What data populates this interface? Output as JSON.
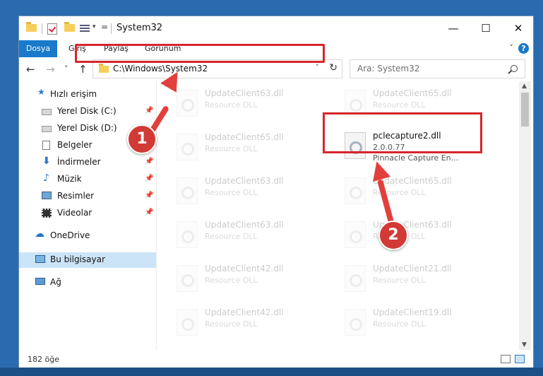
{
  "window": {
    "title": "System32",
    "controls": {
      "minimize": "—",
      "maximize": "☐",
      "close": "✕"
    }
  },
  "ribbon": {
    "tabs": [
      "Dosya",
      "Giriş",
      "Paylaş",
      "Görünüm"
    ],
    "help_label": "?"
  },
  "nav": {
    "back": "←",
    "forward": "→",
    "recent": "˅",
    "up": "↑",
    "address": "C:\\Windows\\System32",
    "search_placeholder": "Ara: System32"
  },
  "sidebar": {
    "quick_access": "Hızlı erişim",
    "items": [
      {
        "label": "Yerel Disk (C:)"
      },
      {
        "label": "Yerel Disk (D:)"
      },
      {
        "label": "Belgeler"
      },
      {
        "label": "İndirmeler"
      },
      {
        "label": "Müzik"
      },
      {
        "label": "Resimler"
      },
      {
        "label": "Videolar"
      }
    ],
    "onedrive": "OneDrive",
    "this_pc": "Bu bilgisayar",
    "network": "Ağ"
  },
  "files": {
    "faded_name_pairs": [
      [
        "UpdateClient63.dll",
        "UpdateClient65.dll"
      ],
      [
        "UpdateClient65.dll",
        ""
      ],
      [
        "UpdateClient63.dll",
        "UpdateClient65.dll"
      ],
      [
        "UpdateClient63.dll",
        "UpdateClient63.dll"
      ],
      [
        "UpdateClient42.dll",
        "UpdateClient21.dll"
      ],
      [
        "UpdateClient42.dll",
        "UpdateClient19.dll"
      ]
    ],
    "faded_type": "Resource DLL",
    "highlighted": {
      "name": "pclecapture2.dll",
      "version": "2.0.0.77",
      "description": "Pinnacle Capture En..."
    }
  },
  "annotations": {
    "badge1": "1",
    "badge2": "2"
  },
  "status": {
    "count": "182 öğe"
  }
}
